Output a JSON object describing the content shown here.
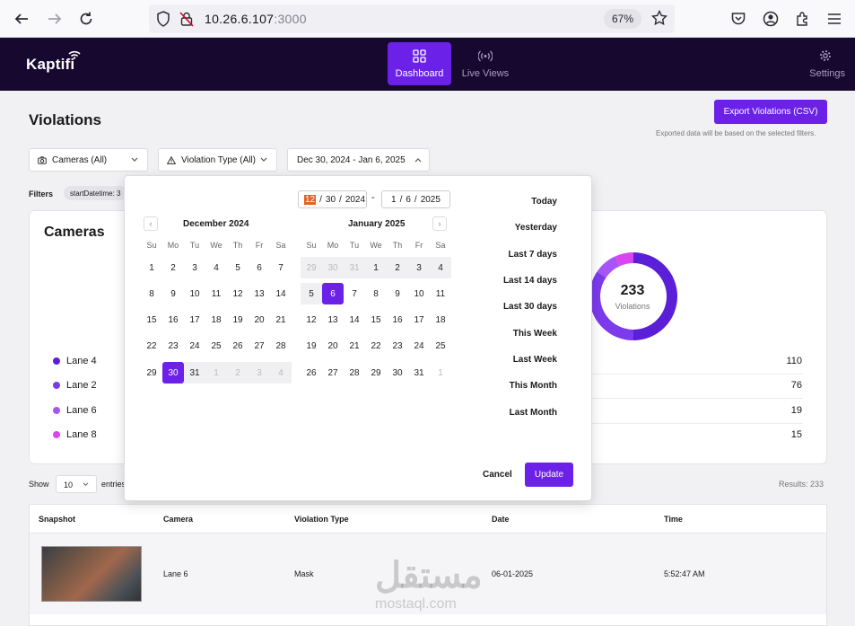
{
  "browser": {
    "url_host": "10.26.6.107",
    "url_port": ":3000",
    "zoom": "67%"
  },
  "nav": {
    "logo": "Kaptifi",
    "dashboard": "Dashboard",
    "live_views": "Live Views",
    "settings": "Settings"
  },
  "page": {
    "title": "Violations",
    "export_button": "Export Violations (CSV)",
    "export_note": "Exported data will be based on the selected filters.",
    "camera_filter": "Cameras (All)",
    "violation_filter": "Violation Type (All)",
    "date_filter": "Dec 30, 2024 - Jan 6, 2025",
    "filters_label": "Filters",
    "filter_chip": "startDatetime: 3"
  },
  "cameras_card": {
    "title": "Cameras",
    "total": "233",
    "total_label": "Violations",
    "lanes": [
      {
        "name": "Lane 4",
        "value": "110",
        "color": "#5a1fd6"
      },
      {
        "name": "Lane 2",
        "value": "76",
        "color": "#7c3aed"
      },
      {
        "name": "Lane 6",
        "value": "19",
        "color": "#a855f7"
      },
      {
        "name": "Lane 8",
        "value": "15",
        "color": "#d946ef"
      }
    ]
  },
  "table_controls": {
    "show": "Show",
    "page_size": "10",
    "entries": "entries",
    "results": "Results: 233"
  },
  "table": {
    "headers": [
      "Snapshot",
      "Camera",
      "Violation Type",
      "Date",
      "Time"
    ],
    "rows": [
      {
        "camera": "Lane 6",
        "type": "Mask",
        "date": "06-01-2025",
        "time": "5:52:47 AM"
      }
    ]
  },
  "calendar": {
    "start": {
      "d": "12",
      "m": "30",
      "y": "2024"
    },
    "end": {
      "d": "1",
      "m": "6",
      "y": "2025"
    },
    "separator": "-",
    "left_month": "December 2024",
    "right_month": "January 2025",
    "weekdays": [
      "Su",
      "Mo",
      "Tu",
      "We",
      "Th",
      "Fr",
      "Sa"
    ],
    "left_days": [
      "1",
      "2",
      "3",
      "4",
      "5",
      "6",
      "7",
      "8",
      "9",
      "10",
      "11",
      "12",
      "13",
      "14",
      "15",
      "16",
      "17",
      "18",
      "19",
      "20",
      "21",
      "22",
      "23",
      "24",
      "25",
      "26",
      "27",
      "28",
      "29",
      "30",
      "31",
      "1",
      "2",
      "3",
      "4"
    ],
    "right_days": [
      "29",
      "30",
      "31",
      "1",
      "2",
      "3",
      "4",
      "5",
      "6",
      "7",
      "8",
      "9",
      "10",
      "11",
      "12",
      "13",
      "14",
      "15",
      "16",
      "17",
      "18",
      "19",
      "20",
      "21",
      "22",
      "23",
      "24",
      "25",
      "26",
      "27",
      "28",
      "29",
      "30",
      "31",
      "1"
    ],
    "presets": [
      "Today",
      "Yesterday",
      "Last 7 days",
      "Last 14 days",
      "Last 30 days",
      "This Week",
      "Last Week",
      "This Month",
      "Last Month"
    ],
    "cancel": "Cancel",
    "update": "Update"
  },
  "watermark": {
    "arabic": "مستقل",
    "latin": "mostaql.com"
  }
}
